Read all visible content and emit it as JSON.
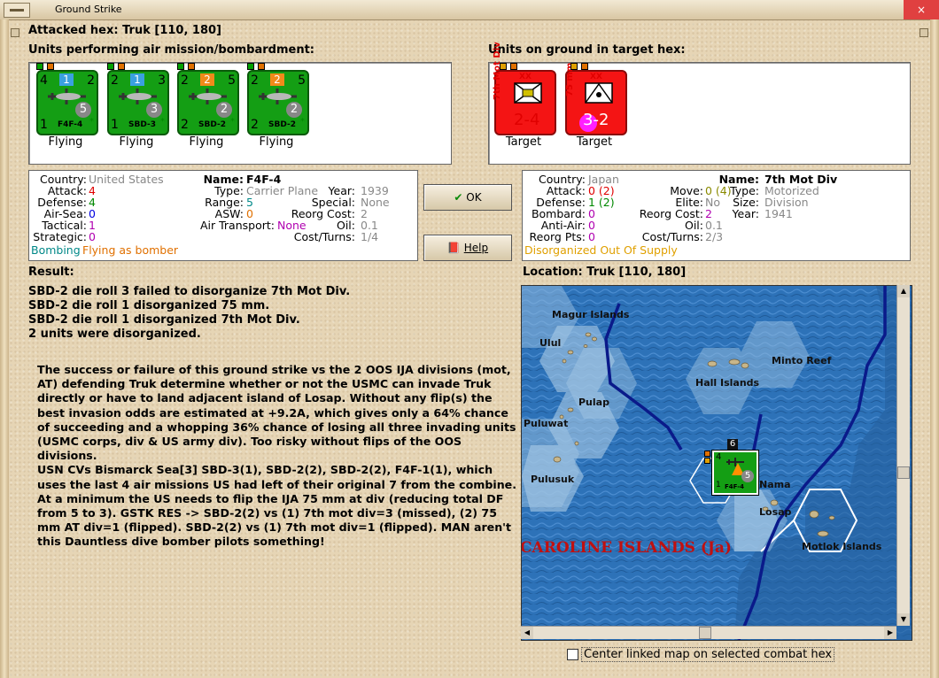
{
  "window": {
    "title": "Ground Strike"
  },
  "header": {
    "attacked_hex": "Attacked hex: Truk  [110, 180]"
  },
  "air_units": {
    "label": "Units performing air mission/bombardment:",
    "items": [
      {
        "tl": "4",
        "tr": "2",
        "bl": "1",
        "name": "F4F-4",
        "circle": "5",
        "flag": "1",
        "flag_color": "#3aa0e0",
        "status": "Flying"
      },
      {
        "tl": "2",
        "tr": "3",
        "bl": "1",
        "name": "SBD-3",
        "circle": "3",
        "flag": "1",
        "flag_color": "#3aa0e0",
        "status": "Flying"
      },
      {
        "tl": "2",
        "tr": "5",
        "bl": "2",
        "name": "SBD-2",
        "circle": "2",
        "flag": "2",
        "flag_color": "#f08a1a",
        "status": "Flying"
      },
      {
        "tl": "2",
        "tr": "5",
        "bl": "2",
        "name": "SBD-2",
        "circle": "2",
        "flag": "2",
        "flag_color": "#f08a1a",
        "status": "Flying"
      }
    ]
  },
  "ground_units": {
    "label": "Units on ground in target hex:",
    "items": [
      {
        "side": "7th Mot Div",
        "size": "XX",
        "vals": "2-4",
        "status": "Target"
      },
      {
        "side": "75 mm",
        "size": "XX",
        "vals": "3-2",
        "status": "Target"
      }
    ]
  },
  "air_info": {
    "country_k": "Country:",
    "country_v": "United States",
    "attack_k": "Attack:",
    "attack_v": "4",
    "defense_k": "Defense:",
    "defense_v": "4",
    "airsea_k": "Air-Sea:",
    "airsea_v": "0",
    "tactical_k": "Tactical:",
    "tactical_v": "1",
    "strategic_k": "Strategic:",
    "strategic_v": "0",
    "mission_a": "Bombing",
    "mission_b": "Flying as bomber",
    "name_k": "Name:",
    "name_v": "F4F-4",
    "type_k": "Type:",
    "type_v": "Carrier Plane",
    "range_k": "Range:",
    "range_v": "5",
    "asw_k": "ASW:",
    "asw_v": "0",
    "airtransport_k": "Air Transport:",
    "airtransport_v": "None",
    "year_k": "Year:",
    "year_v": "1939",
    "special_k": "Special:",
    "special_v": "None",
    "reorg_k": "Reorg Cost:",
    "reorg_v": "2",
    "oil_k": "Oil:",
    "oil_v": "0.1",
    "costturns_k": "Cost/Turns:",
    "costturns_v": "1/4"
  },
  "buttons": {
    "ok": "OK",
    "help": "Help"
  },
  "ground_info": {
    "country_k": "Country:",
    "country_v": "Japan",
    "attack_k": "Attack:",
    "attack_v": "0 (2)",
    "defense_k": "Defense:",
    "defense_v": "1 (2)",
    "bombard_k": "Bombard:",
    "bombard_v": "0",
    "antiair_k": "Anti-Air:",
    "antiair_v": "0",
    "reorgpts_k": "Reorg Pts:",
    "reorgpts_v": "0",
    "status_v": "Disorganized Out Of Supply",
    "move_k": "Move:",
    "move_v": "0 (4)",
    "elite_k": "Elite:",
    "elite_v": "No",
    "reorg_k": "Reorg Cost:",
    "reorg_v": "2",
    "oil_k": "Oil:",
    "oil_v": "0.1",
    "costturns_k": "Cost/Turns:",
    "costturns_v": "2/3",
    "name_k": "Name:",
    "name_v": "7th Mot Div",
    "type_k": "Type:",
    "type_v": "Motorized",
    "size_k": "Size:",
    "size_v": "Division",
    "year_k": "Year:",
    "year_v": "1941"
  },
  "result": {
    "label": "Result:",
    "lines": [
      "SBD-2 die roll 3 failed to disorganize 7th Mot Div.",
      "SBD-2 die roll 1 disorganized 75 mm.",
      "SBD-2 die roll 1 disorganized 7th Mot Div.",
      "2 units were disorganized."
    ],
    "para1": "The success or failure of this ground strike vs the 2 OOS IJA divisions (mot, AT) defending Truk determine whether or not the USMC can invade Truk directly or have to land adjacent island of Losap. Without any flip(s) the best invasion odds are estimated at +9.2A, which gives only a 64% chance of succeeding and a whopping 36% chance of losing all three invading units (USMC corps, div & US army div).  Too risky without flips of the OOS divisions.",
    "para2": "USN CVs Bismarck Sea[3]  SBD-3(1), SBD-2(2), SBD-2(2), F4F-1(1), which uses the last 4 air missions US had left of their original 7 from the combine.",
    "para3": "At a minimum the US needs to flip the IJA 75 mm at div (reducing total DF from 5 to 3).   GSTK RES -> SBD-2(2) vs (1) 7th mot div=3 (missed), (2) 75 mm AT div=1 (flipped).  SBD-2(2) vs (1) 7th mot div=1 (flipped).  MAN aren't this Dauntless dive bomber pilots something!"
  },
  "location": {
    "label": "Location:  Truk  [110, 180]"
  },
  "map": {
    "labels": [
      "Magur Islands",
      "Ulul",
      "Minto Reef",
      "Hall Islands",
      "Pulap",
      "Puluwat",
      "Pulusuk",
      "Nama",
      "Losap",
      "Motlok Islands"
    ],
    "region": "CAROLINE ISLANDS (Ja)",
    "stack_count": "6",
    "unit": {
      "tl": "4",
      "name": "F4F-4",
      "circle": "5",
      "bl": "1"
    }
  },
  "footer": {
    "center_link": "Center linked map on selected combat hex"
  }
}
